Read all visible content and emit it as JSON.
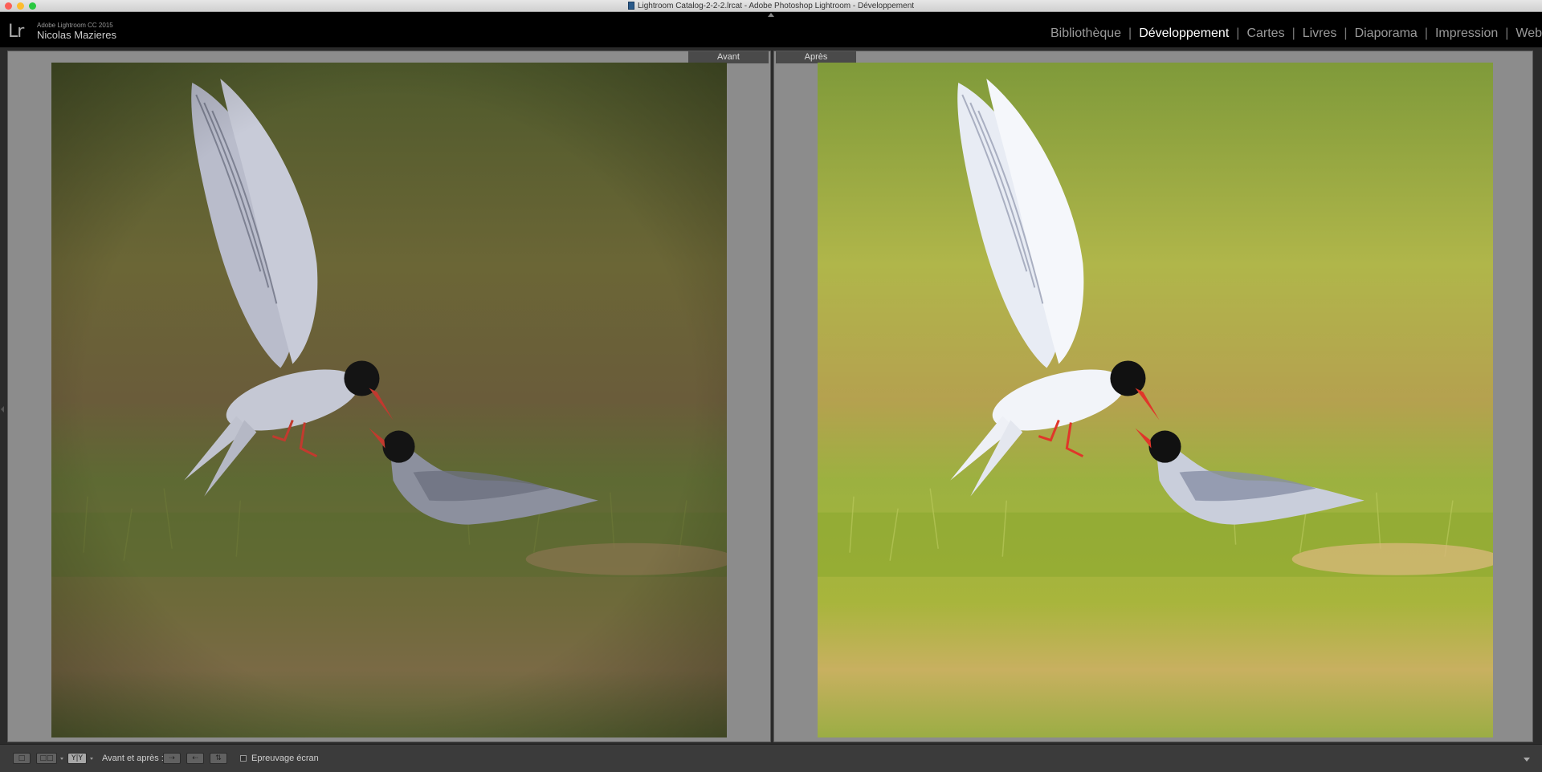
{
  "window": {
    "title": "Lightroom  Catalog-2-2-2.lrcat - Adobe Photoshop Lightroom - Développement"
  },
  "identity": {
    "logo": "Lr",
    "product": "Adobe Lightroom CC 2015",
    "user": "Nicolas Mazieres"
  },
  "modules": [
    {
      "label": "Bibliothèque",
      "active": false
    },
    {
      "label": "Développement",
      "active": true
    },
    {
      "label": "Cartes",
      "active": false
    },
    {
      "label": "Livres",
      "active": false
    },
    {
      "label": "Diaporama",
      "active": false
    },
    {
      "label": "Impression",
      "active": false
    },
    {
      "label": "Web",
      "active": false
    }
  ],
  "module_separator": "|",
  "compare": {
    "before_label": "Avant",
    "after_label": "Après"
  },
  "toolbar": {
    "view_before_after_label": "Avant et après :",
    "compare_view_glyph": "Y|Y",
    "soft_proof_label": "Epreuvage écran"
  },
  "colors": {
    "accent_before_grass": "#6e6a3a",
    "accent_after_grass": "#a8b53c"
  },
  "icons": {
    "logo": "lightroom-logo",
    "loupe_view": "single-view-icon",
    "compare_view": "compare-view-icon",
    "before_after_view": "before-after-view-icon",
    "copy_before_to_after": "copy-before-to-after-icon",
    "copy_after_to_before": "copy-after-to-before-icon",
    "swap": "swap-icon",
    "toolbar_menu": "chevron-down-icon"
  }
}
